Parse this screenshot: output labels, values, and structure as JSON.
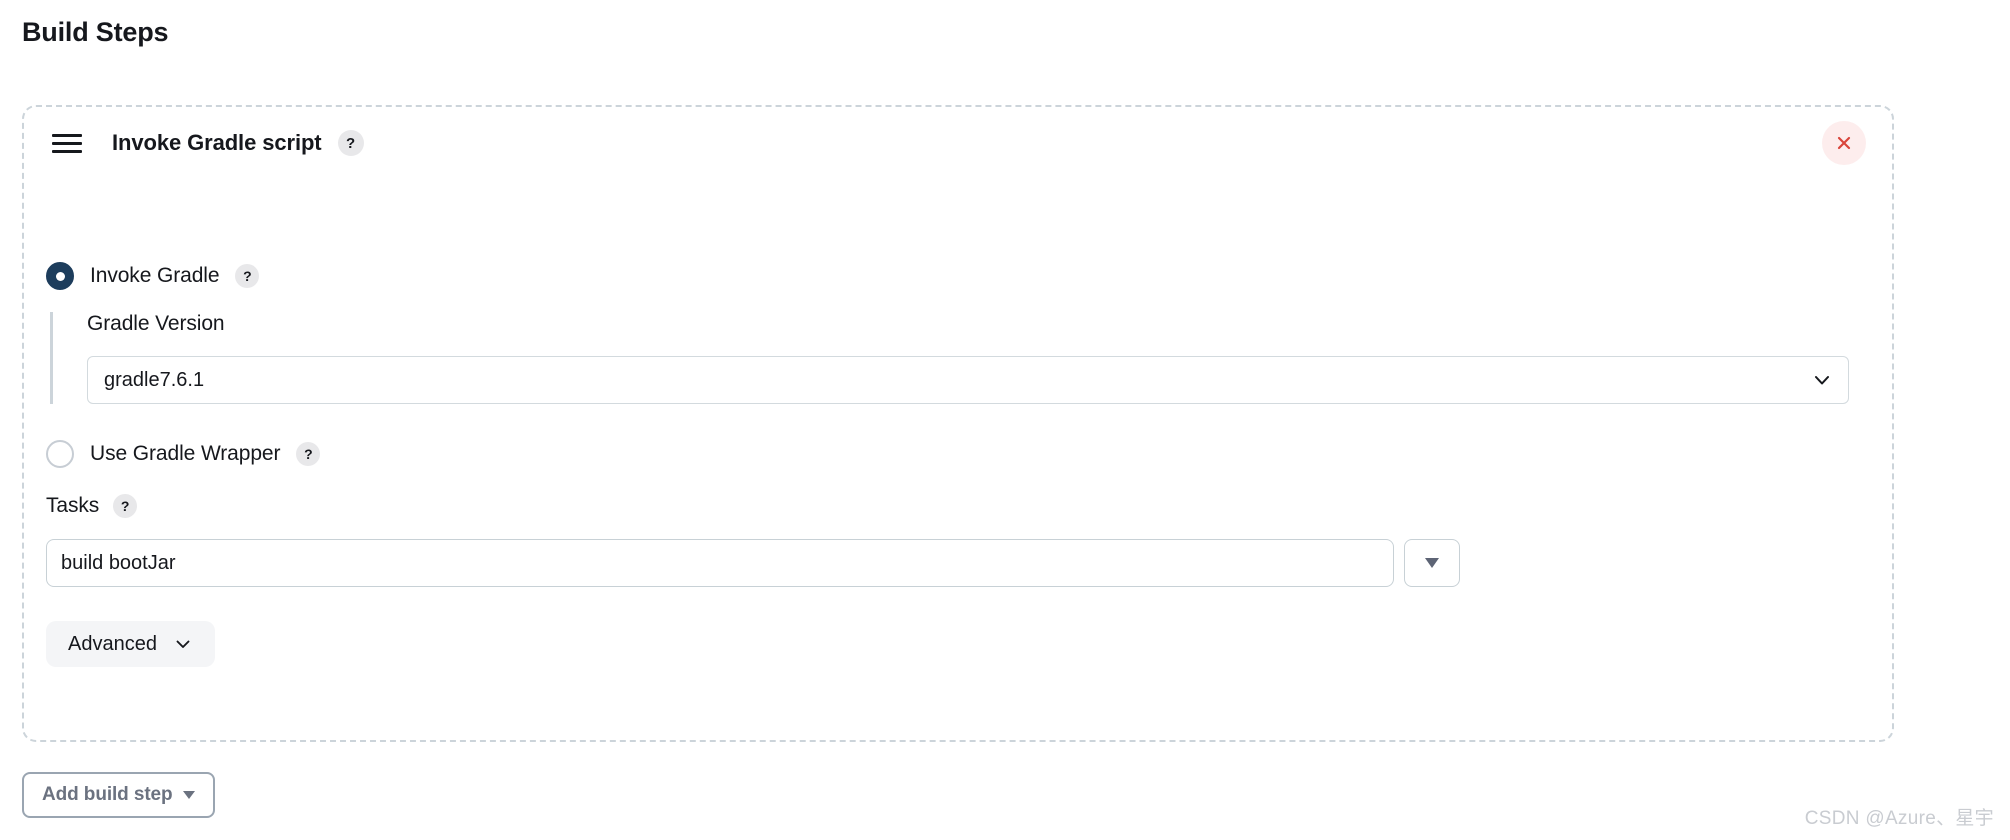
{
  "page": {
    "title": "Build Steps"
  },
  "build_step": {
    "drag_handle_icon": "hamburger-drag-handle-icon",
    "title": "Invoke Gradle script",
    "title_help": "?",
    "close_icon": "close-x-icon",
    "close_color": "#d9453b",
    "close_bg": "#fdeded",
    "border_style": "dashed",
    "border_color": "#ccd4da"
  },
  "mode_options": [
    {
      "id": "invoke-gradle",
      "label": "Invoke Gradle",
      "help": "?",
      "selected": true,
      "selected_color": "#1d3d5c"
    },
    {
      "id": "use-gradle-wrapper",
      "label": "Use Gradle Wrapper",
      "help": "?",
      "selected": false,
      "unselected_color": "#c7cdd4"
    }
  ],
  "gradle_version": {
    "label": "Gradle Version",
    "value": "gradle7.6.1",
    "chevron_icon": "chevron-down-icon",
    "options": [
      "gradle7.6.1"
    ]
  },
  "tasks": {
    "label": "Tasks",
    "help": "?",
    "value": "build bootJar",
    "placeholder": "",
    "dropdown_icon": "caret-down-icon"
  },
  "advanced": {
    "label": "Advanced",
    "chevron_icon": "chevron-down-icon",
    "expanded": false
  },
  "footer": {
    "add_build_step_label": "Add build step",
    "add_build_step_caret": "caret-down-icon"
  },
  "watermark": {
    "text": "CSDN @Azure、星宇"
  }
}
